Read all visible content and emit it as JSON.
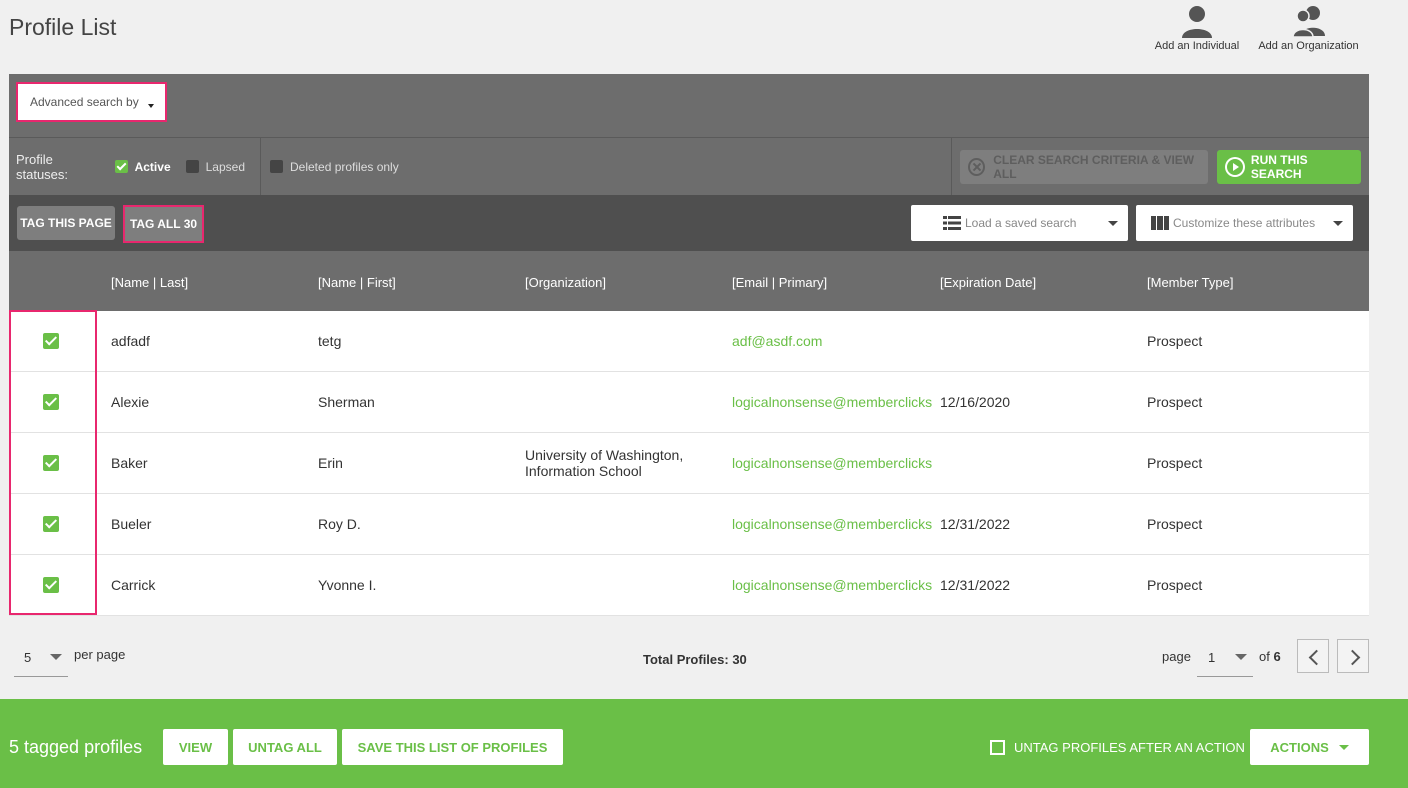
{
  "page": {
    "title": "Profile List"
  },
  "header_actions": {
    "add_individual": "Add an Individual",
    "add_organization": "Add an Organization"
  },
  "search": {
    "advanced_label": "Advanced search by"
  },
  "statuses": {
    "label": "Profile statuses:",
    "active": {
      "label": "Active",
      "checked": true
    },
    "lapsed": {
      "label": "Lapsed",
      "checked": false
    },
    "deleted": {
      "label": "Deleted profiles only",
      "checked": false
    }
  },
  "search_actions": {
    "clear": "CLEAR SEARCH CRITERIA & VIEW ALL",
    "run": "RUN THIS SEARCH"
  },
  "tag_bar": {
    "tag_page": "TAG THIS PAGE",
    "tag_all": "TAG ALL 30",
    "load_saved": "Load a saved search",
    "customize": "Customize these attributes"
  },
  "table": {
    "columns": [
      "[Name | Last]",
      "[Name | First]",
      "[Organization]",
      "[Email | Primary]",
      "[Expiration Date]",
      "[Member Type]"
    ],
    "rows": [
      {
        "last": "adfadf",
        "first": "tetg",
        "org": "",
        "email": "adf@asdf.com",
        "expiration": "",
        "type": "Prospect",
        "checked": true
      },
      {
        "last": "Alexie",
        "first": "Sherman",
        "org": "",
        "email": "logicalnonsense@memberclicks",
        "expiration": "12/16/2020",
        "type": "Prospect",
        "checked": true
      },
      {
        "last": "Baker",
        "first": "Erin",
        "org": "University of Washington, Information School",
        "email": "logicalnonsense@memberclicks",
        "expiration": "",
        "type": "Prospect",
        "checked": true
      },
      {
        "last": "Bueler",
        "first": "Roy D.",
        "org": "",
        "email": "logicalnonsense@memberclicks",
        "expiration": "12/31/2022",
        "type": "Prospect",
        "checked": true
      },
      {
        "last": "Carrick",
        "first": "Yvonne I.",
        "org": "",
        "email": "logicalnonsense@memberclicks",
        "expiration": "12/31/2022",
        "type": "Prospect",
        "checked": true
      }
    ]
  },
  "pagination": {
    "per_page_value": "5",
    "per_page_label": "per page",
    "total": "Total Profiles: 30",
    "page_label": "page",
    "page_value": "1",
    "of_label": "of",
    "total_pages": "6"
  },
  "footer": {
    "tagged": "5 tagged profiles",
    "view": "VIEW",
    "untag_all": "UNTAG ALL",
    "save_list": "SAVE THIS LIST OF PROFILES",
    "untag_after": "UNTAG PROFILES AFTER AN ACTION",
    "actions": "ACTIONS"
  },
  "colors": {
    "accent_green": "#6abf47",
    "highlight_pink": "#e8276e",
    "panel_gray": "#6d6d6d",
    "tagbar_gray": "#4f4f4f"
  }
}
